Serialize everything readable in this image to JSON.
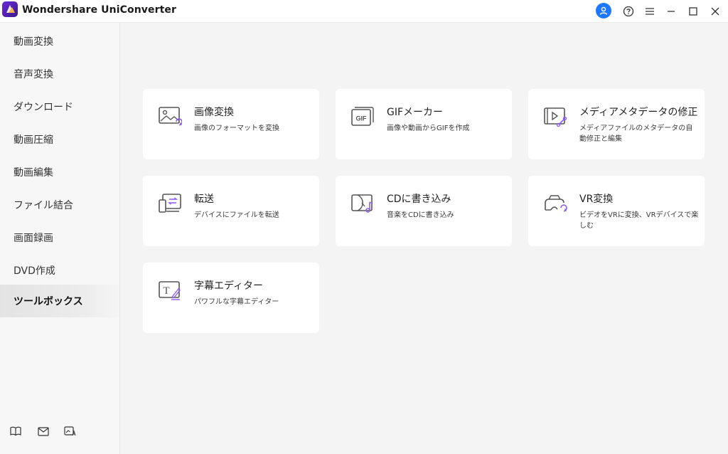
{
  "app": {
    "title": "Wondershare UniConverter"
  },
  "titlebar_icons": [
    "user-icon",
    "help-icon",
    "menu-icon",
    "minimize-icon",
    "maximize-icon",
    "close-icon"
  ],
  "sidebar": {
    "items": [
      {
        "label": "動画変換"
      },
      {
        "label": "音声変換"
      },
      {
        "label": "ダウンロード"
      },
      {
        "label": "動画圧縮"
      },
      {
        "label": "動画編集"
      },
      {
        "label": "ファイル結合"
      },
      {
        "label": "画面録画"
      },
      {
        "label": "DVD作成"
      },
      {
        "label": "ツールボックス",
        "active": true
      }
    ],
    "footer_icons": [
      "book-icon",
      "mail-icon",
      "image-ai-icon"
    ]
  },
  "tools": [
    {
      "title": "画像変換",
      "desc": "画像のフォーマットを変換",
      "icon": "image-convert-icon"
    },
    {
      "title": "GIFメーカー",
      "desc": "画像や動画からGIFを作成",
      "icon": "gif-maker-icon",
      "icon_text": "GIF"
    },
    {
      "title": "メディアメタデータの修正",
      "desc": "メディアファイルのメタデータの自動修正と編集",
      "icon": "metadata-icon"
    },
    {
      "title": "転送",
      "desc": "デバイスにファイルを転送",
      "icon": "transfer-icon"
    },
    {
      "title": "CDに書き込み",
      "desc": "音楽をCDに書き込み",
      "icon": "cd-burn-icon"
    },
    {
      "title": "VR変換",
      "desc": "ビデオをVRに変換、VRデバイスで楽しむ",
      "icon": "vr-convert-icon"
    },
    {
      "title": "字幕エディター",
      "desc": "パワフルな字幕エディター",
      "icon": "subtitle-editor-icon",
      "icon_text": "T"
    }
  ],
  "colors": {
    "accent": "#8b5cf6",
    "user_button": "#1e78ff",
    "background": "#f4f4f4",
    "card": "#ffffff"
  }
}
